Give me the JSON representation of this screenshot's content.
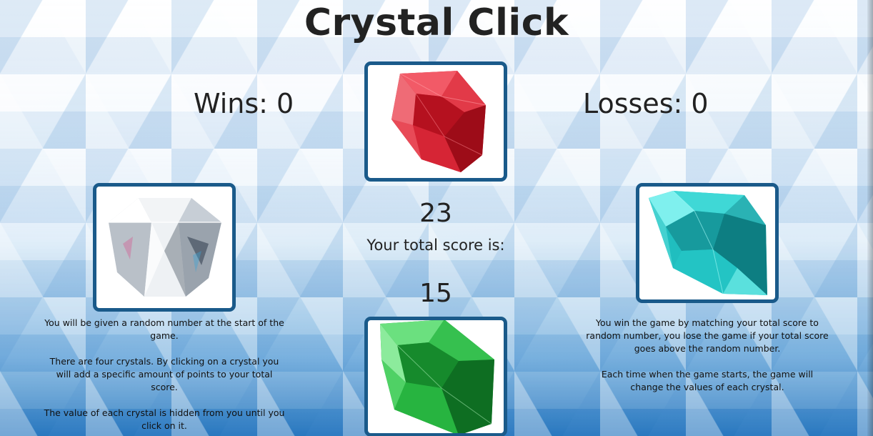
{
  "page": {
    "title": "Crystal Click"
  },
  "stats": {
    "wins": "Wins: 0",
    "losses": "Losses: 0"
  },
  "game": {
    "target_number": "23",
    "score_label": "Your total score is:",
    "total_score": "15"
  },
  "crystals": [
    {
      "name": "red",
      "color": "#d2202f"
    },
    {
      "name": "white",
      "color": "#e8eef3"
    },
    {
      "name": "cyan",
      "color": "#25c7c7"
    },
    {
      "name": "green",
      "color": "#21b03b"
    }
  ],
  "instructions_left": [
    "You will be given a random number at the start of the game.",
    "There are four crystals. By clicking on a crystal you will add a specific amount of points to your total score.",
    "The value of each crystal is hidden from you until you click on it."
  ],
  "instructions_right": [
    "You win the game by matching your total score to random number, you lose the game if your total score goes above the random number.",
    "Each time when the game starts, the game will change the values of each crystal."
  ],
  "colors": {
    "frame_border": "#1a5a8a",
    "text": "#222222",
    "background_accent": "#2676be"
  }
}
